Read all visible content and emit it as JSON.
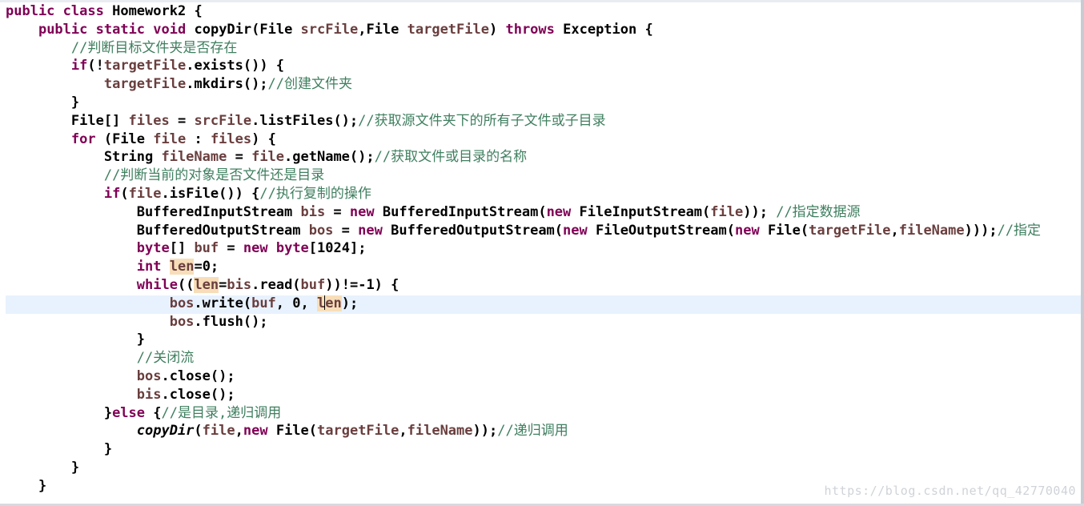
{
  "editor": {
    "lines": [
      [
        [
          "kw",
          "public"
        ],
        [
          "t",
          " "
        ],
        [
          "kw",
          "class"
        ],
        [
          "t",
          " Homework2 {"
        ]
      ],
      [
        [
          "t",
          "    "
        ],
        [
          "kw",
          "public"
        ],
        [
          "t",
          " "
        ],
        [
          "kw",
          "static"
        ],
        [
          "t",
          " "
        ],
        [
          "kw",
          "void"
        ],
        [
          "t",
          " copyDir(File "
        ],
        [
          "var",
          "srcFile"
        ],
        [
          "t",
          ",File "
        ],
        [
          "var",
          "targetFile"
        ],
        [
          "t",
          ") "
        ],
        [
          "kw",
          "throws"
        ],
        [
          "t",
          " Exception {"
        ]
      ],
      [
        [
          "t",
          "        "
        ],
        [
          "cmt",
          "//判断目标文件夹是否存在"
        ]
      ],
      [
        [
          "t",
          "        "
        ],
        [
          "kw",
          "if"
        ],
        [
          "t",
          "(!"
        ],
        [
          "var",
          "targetFile"
        ],
        [
          "t",
          ".exists()) {"
        ]
      ],
      [
        [
          "t",
          "            "
        ],
        [
          "var",
          "targetFile"
        ],
        [
          "t",
          ".mkdirs();"
        ],
        [
          "cmt",
          "//创建文件夹"
        ]
      ],
      [
        [
          "t",
          "        }"
        ]
      ],
      [
        [
          "t",
          "        File[] "
        ],
        [
          "var",
          "files"
        ],
        [
          "t",
          " = "
        ],
        [
          "var",
          "srcFile"
        ],
        [
          "t",
          ".listFiles();"
        ],
        [
          "cmt",
          "//获取源文件夹下的所有子文件或子目录"
        ]
      ],
      [
        [
          "t",
          "        "
        ],
        [
          "kw",
          "for"
        ],
        [
          "t",
          " (File "
        ],
        [
          "var",
          "file"
        ],
        [
          "t",
          " : "
        ],
        [
          "var",
          "files"
        ],
        [
          "t",
          ") {"
        ]
      ],
      [
        [
          "t",
          "            String "
        ],
        [
          "var",
          "fileName"
        ],
        [
          "t",
          " = "
        ],
        [
          "var",
          "file"
        ],
        [
          "t",
          ".getName();"
        ],
        [
          "cmt",
          "//获取文件或目录的名称"
        ]
      ],
      [
        [
          "t",
          "            "
        ],
        [
          "cmt",
          "//判断当前的对象是否文件还是目录"
        ]
      ],
      [
        [
          "t",
          "            "
        ],
        [
          "kw",
          "if"
        ],
        [
          "t",
          "("
        ],
        [
          "var",
          "file"
        ],
        [
          "t",
          ".isFile()) {"
        ],
        [
          "cmt",
          "//执行复制的操作"
        ]
      ],
      [
        [
          "t",
          "                BufferedInputStream "
        ],
        [
          "var",
          "bis"
        ],
        [
          "t",
          " = "
        ],
        [
          "kw",
          "new"
        ],
        [
          "t",
          " BufferedInputStream("
        ],
        [
          "kw",
          "new"
        ],
        [
          "t",
          " FileInputStream("
        ],
        [
          "var",
          "file"
        ],
        [
          "t",
          "));"
        ],
        [
          "t",
          " "
        ],
        [
          "cmt",
          "//指定数据源"
        ]
      ],
      [
        [
          "t",
          "                BufferedOutputStream "
        ],
        [
          "var",
          "bos"
        ],
        [
          "t",
          " = "
        ],
        [
          "kw",
          "new"
        ],
        [
          "t",
          " BufferedOutputStream("
        ],
        [
          "kw",
          "new"
        ],
        [
          "t",
          " FileOutputStream("
        ],
        [
          "kw",
          "new"
        ],
        [
          "t",
          " File("
        ],
        [
          "var",
          "targetFile"
        ],
        [
          "t",
          ","
        ],
        [
          "var",
          "fileName"
        ],
        [
          "t",
          ")));"
        ],
        [
          "cmt",
          "//指定"
        ]
      ],
      [
        [
          "t",
          "                "
        ],
        [
          "kw",
          "byte"
        ],
        [
          "t",
          "[] "
        ],
        [
          "var",
          "buf"
        ],
        [
          "t",
          " = "
        ],
        [
          "kw",
          "new"
        ],
        [
          "t",
          " "
        ],
        [
          "kw",
          "byte"
        ],
        [
          "t",
          "[1024];"
        ]
      ],
      [
        [
          "t",
          "                "
        ],
        [
          "kw",
          "int"
        ],
        [
          "t",
          " "
        ],
        [
          "varhl",
          "len"
        ],
        [
          "t",
          "=0;"
        ]
      ],
      [
        [
          "t",
          "                "
        ],
        [
          "kw",
          "while"
        ],
        [
          "t",
          "(("
        ],
        [
          "varhl",
          "len"
        ],
        [
          "t",
          "="
        ],
        [
          "var",
          "bis"
        ],
        [
          "t",
          ".read("
        ],
        [
          "var",
          "buf"
        ],
        [
          "t",
          "))!=-1) {"
        ]
      ],
      [
        [
          "t",
          "                    "
        ],
        [
          "var",
          "bos"
        ],
        [
          "t",
          ".write("
        ],
        [
          "var",
          "buf"
        ],
        [
          "t",
          ", 0, "
        ],
        [
          "varcur",
          "len"
        ],
        [
          "t",
          ");"
        ]
      ],
      [
        [
          "t",
          "                    "
        ],
        [
          "var",
          "bos"
        ],
        [
          "t",
          ".flush();"
        ]
      ],
      [
        [
          "t",
          "                }"
        ]
      ],
      [
        [
          "t",
          "                "
        ],
        [
          "cmt",
          "//关闭流"
        ]
      ],
      [
        [
          "t",
          "                "
        ],
        [
          "var",
          "bos"
        ],
        [
          "t",
          ".close();"
        ]
      ],
      [
        [
          "t",
          "                "
        ],
        [
          "var",
          "bis"
        ],
        [
          "t",
          ".close();"
        ]
      ],
      [
        [
          "t",
          "            }"
        ],
        [
          "kw",
          "else"
        ],
        [
          "t",
          " {"
        ],
        [
          "cmt",
          "//是目录,递归调用"
        ]
      ],
      [
        [
          "t",
          "                "
        ],
        [
          "it",
          "copyDir"
        ],
        [
          "t",
          "("
        ],
        [
          "var",
          "file"
        ],
        [
          "t",
          ","
        ],
        [
          "kw",
          "new"
        ],
        [
          "t",
          " File("
        ],
        [
          "var",
          "targetFile"
        ],
        [
          "t",
          ","
        ],
        [
          "var",
          "fileName"
        ],
        [
          "t",
          "));"
        ],
        [
          "cmt",
          "//递归调用"
        ]
      ],
      [
        [
          "t",
          "            }"
        ]
      ],
      [
        [
          "t",
          "        }"
        ]
      ],
      [
        [
          "t",
          "    }"
        ]
      ]
    ]
  },
  "watermark": "https://blog.csdn.net/qq_42770040"
}
